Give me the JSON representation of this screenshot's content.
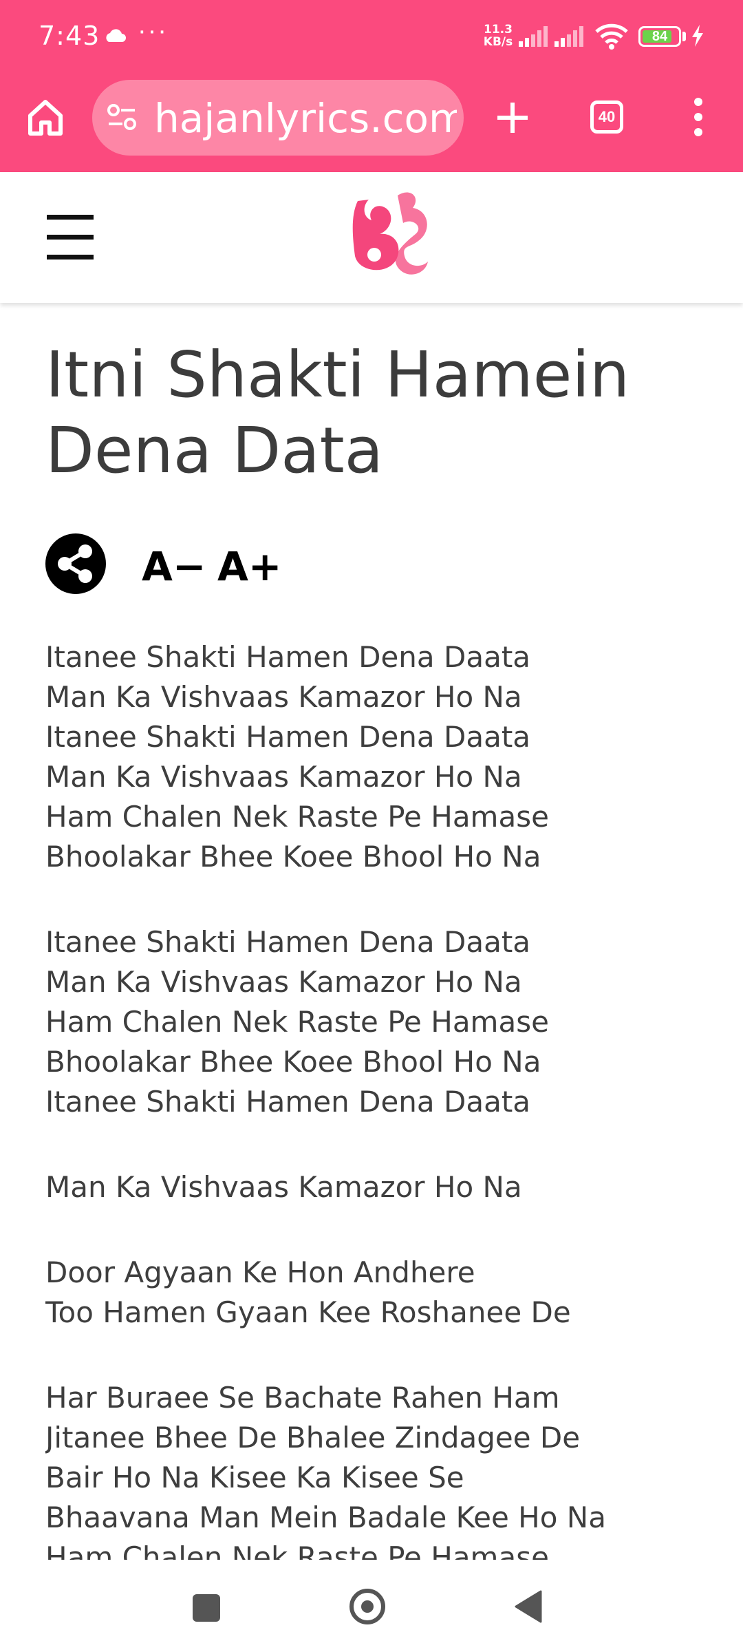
{
  "status_bar": {
    "time": "7:43",
    "overflow_indicator": "···",
    "net_speed_value": "11.3",
    "net_speed_unit": "KB/s",
    "battery_level": "84",
    "battery_color": "#6bd34b"
  },
  "browser": {
    "url": "hajanlyrics.com",
    "tab_count": "40",
    "accent_color": "#fb4a7e"
  },
  "site": {
    "logo_icon": "bhajan-logo-icon",
    "logo_color": "#f4467c"
  },
  "article": {
    "title": "Itni Shakti Hamein Dena Data",
    "font_decrease_label": "A−",
    "font_increase_label": "A+",
    "stanzas": [
      [
        "Itanee Shakti Hamen Dena Daata",
        "Man Ka Vishvaas Kamazor Ho Na",
        "Itanee Shakti Hamen Dena Daata",
        "Man Ka Vishvaas Kamazor Ho Na",
        "Ham Chalen Nek Raste Pe Hamase",
        "Bhoolakar Bhee Koee Bhool Ho Na"
      ],
      [
        "Itanee Shakti Hamen Dena Daata",
        "Man Ka Vishvaas Kamazor Ho Na",
        "Ham Chalen Nek Raste Pe Hamase",
        "Bhoolakar Bhee Koee Bhool Ho Na",
        "Itanee Shakti Hamen Dena Daata"
      ],
      [
        "Man Ka Vishvaas Kamazor Ho Na"
      ],
      [
        "Door Agyaan Ke Hon Andhere",
        "Too Hamen Gyaan Kee Roshanee De"
      ],
      [
        "Har Buraee Se Bachate Rahen Ham",
        "Jitanee Bhee De Bhalee Zindagee De",
        "Bair Ho Na Kisee Ka Kisee Se",
        "Bhaavana Man Mein Badale Kee Ho Na",
        "Ham Chalen Nek Raste Pe Hamase"
      ]
    ]
  }
}
